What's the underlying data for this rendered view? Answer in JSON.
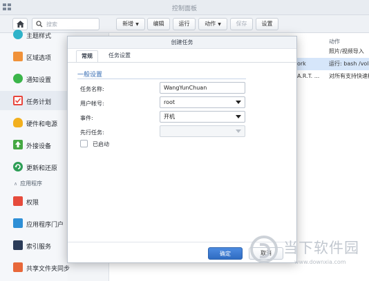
{
  "window": {
    "title": "控制面板"
  },
  "toolbar": {
    "search_placeholder": "搜索",
    "buttons": [
      {
        "label": "新增",
        "caret": "▼",
        "disabled": false
      },
      {
        "label": "编辑",
        "caret": "",
        "disabled": false
      },
      {
        "label": "运行",
        "caret": "",
        "disabled": false
      },
      {
        "label": "动作",
        "caret": "▼",
        "disabled": false
      },
      {
        "label": "保存",
        "caret": "",
        "disabled": true
      },
      {
        "label": "设置",
        "caret": "",
        "disabled": false
      }
    ]
  },
  "sidebar": {
    "items": [
      {
        "label": "主题样式",
        "icon": "theme-icon",
        "color": "#2fb3c9"
      },
      {
        "label": "区域选项",
        "icon": "region-icon",
        "color": "#f0923a"
      },
      {
        "label": "通知设置",
        "icon": "notification-icon",
        "color": "#3bb54a"
      },
      {
        "label": "任务计划",
        "icon": "calendar-icon",
        "color": "#e8453c"
      },
      {
        "label": "硬件和电源",
        "icon": "lightbulb-icon",
        "color": "#f2b01e"
      },
      {
        "label": "外接设备",
        "icon": "upload-icon",
        "color": "#45a843"
      },
      {
        "label": "更新和还原",
        "icon": "update-icon",
        "color": "#2e9e57"
      }
    ],
    "section_label": "应用程序",
    "apps": [
      {
        "label": "权限",
        "icon": "permission-icon",
        "color": "#e64b3c"
      },
      {
        "label": "应用程序门户",
        "icon": "portal-icon",
        "color": "#2e8fd6"
      },
      {
        "label": "索引服务",
        "icon": "index-icon",
        "color": "#2b3b58"
      },
      {
        "label": "共享文件夹同步",
        "icon": "folder-sync-icon",
        "color": "#e8683a"
      }
    ]
  },
  "background_table": {
    "column_header": "动作",
    "rows": [
      {
        "c1": "",
        "c2": "照片/视频导入",
        "selected": false
      },
      {
        "c1": "ork",
        "c2": "运行: bash /volu",
        "selected": true
      },
      {
        "c1": "A.R.T. ...",
        "c2": "对所有支持快速检",
        "selected": false
      }
    ]
  },
  "dialog": {
    "title": "创建任务",
    "tabs": [
      "常规",
      "任务设置"
    ],
    "active_tab": 0,
    "section_title": "一般设置",
    "fields": {
      "task_name_label": "任务名称:",
      "task_name_value": "WangYunChuan",
      "user_label": "用户帐号:",
      "user_value": "root",
      "event_label": "事件:",
      "event_value": "开机",
      "pre_task_label": "先行任务:",
      "pre_task_value": ""
    },
    "enabled_label": "已启动",
    "enabled_checked": false,
    "ok_label": "确定",
    "cancel_label": "取消"
  },
  "watermark": {
    "brand": "当下软件园",
    "url": "www.downxia.com"
  }
}
